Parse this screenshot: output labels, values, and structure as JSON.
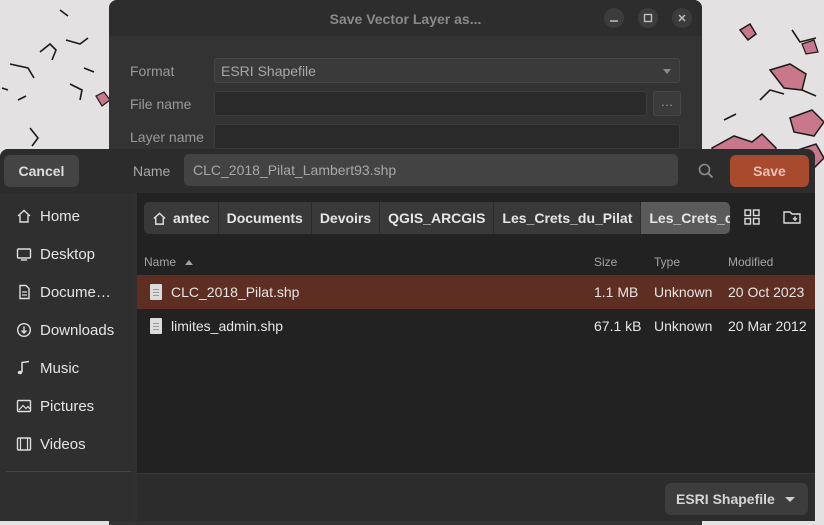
{
  "window": {
    "title": "Save Vector Layer as...",
    "format_label": "Format",
    "format_value": "ESRI Shapefile",
    "filename_label": "File name",
    "filename_value": "",
    "browse_label": "…",
    "layername_label": "Layer name",
    "layername_value": ""
  },
  "chooser": {
    "cancel_label": "Cancel",
    "name_label": "Name",
    "name_value": "CLC_2018_Pilat_Lambert93.shp",
    "save_label": "Save",
    "accent_color": "#a84a2e"
  },
  "sidebar": {
    "items": [
      {
        "label": "Home",
        "icon": "home-icon"
      },
      {
        "label": "Desktop",
        "icon": "desktop-icon"
      },
      {
        "label": "Docume…",
        "icon": "documents-icon"
      },
      {
        "label": "Downloads",
        "icon": "downloads-icon"
      },
      {
        "label": "Music",
        "icon": "music-icon"
      },
      {
        "label": "Pictures",
        "icon": "pictures-icon"
      },
      {
        "label": "Videos",
        "icon": "videos-icon"
      }
    ]
  },
  "pathbar": {
    "crumbs": [
      "antec",
      "Documents",
      "Devoirs",
      "QGIS_ARCGIS",
      "Les_Crets_du_Pilat",
      "Les_Crets_c"
    ]
  },
  "columns": {
    "name": "Name",
    "size": "Size",
    "type": "Type",
    "modified": "Modified"
  },
  "files": [
    {
      "name": "CLC_2018_Pilat.shp",
      "size": "1.1 MB",
      "type": "Unknown",
      "modified": "20 Oct 2023",
      "selected": true
    },
    {
      "name": "limites_admin.shp",
      "size": "67.1 kB",
      "type": "Unknown",
      "modified": "20 Mar 2012",
      "selected": false
    }
  ],
  "filter": {
    "value": "ESRI Shapefile"
  }
}
